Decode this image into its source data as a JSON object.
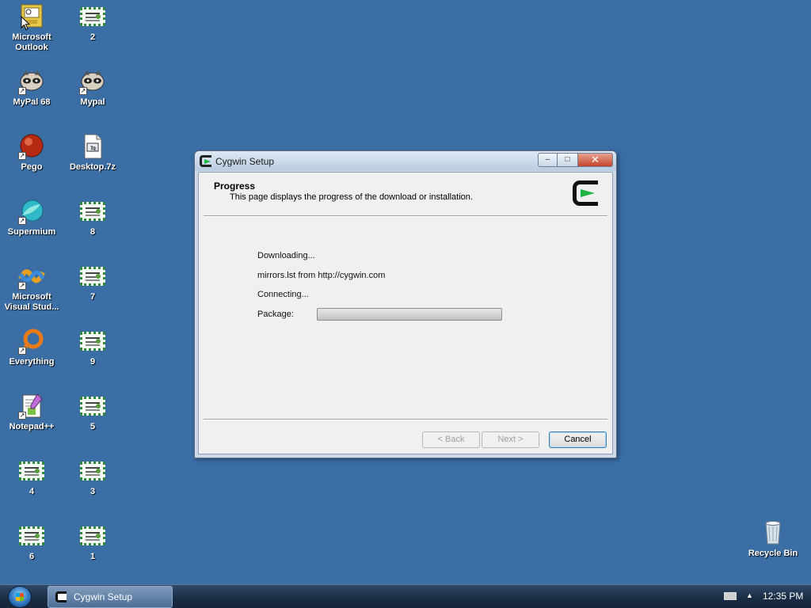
{
  "desktop": {
    "icons": [
      {
        "label": "Microsoft\nOutlook",
        "icon": "outlook-icon"
      },
      {
        "label": "2",
        "icon": "certificate-file-icon"
      },
      {
        "label": "MyPal 68",
        "icon": "raccoon-icon"
      },
      {
        "label": "Mypal",
        "icon": "raccoon-icon"
      },
      {
        "label": "Pego",
        "icon": "red-orb-icon"
      },
      {
        "label": "Desktop.7z",
        "icon": "archive-file-icon"
      },
      {
        "label": "Supermium",
        "icon": "supermium-icon"
      },
      {
        "label": "8",
        "icon": "certificate-file-icon"
      },
      {
        "label": "Microsoft\nVisual Stud...",
        "icon": "visual-studio-icon"
      },
      {
        "label": "7",
        "icon": "certificate-file-icon"
      },
      {
        "label": "Everything",
        "icon": "everything-search-icon"
      },
      {
        "label": "9",
        "icon": "certificate-file-icon"
      },
      {
        "label": "Notepad++",
        "icon": "notepad-plus-plus-icon"
      },
      {
        "label": "5",
        "icon": "certificate-file-icon"
      },
      {
        "label": "4",
        "icon": "certificate-file-icon"
      },
      {
        "label": "3",
        "icon": "certificate-file-icon"
      },
      {
        "label": "6",
        "icon": "certificate-file-icon"
      },
      {
        "label": "1",
        "icon": "certificate-file-icon"
      },
      {
        "label": "Recycle Bin",
        "icon": "recycle-bin-icon"
      }
    ]
  },
  "window": {
    "title": "Cygwin Setup",
    "controls": {
      "minimize": "–",
      "maximize": "□",
      "close": "✕"
    },
    "heading": "Progress",
    "subheading": "This page displays the progress of the download or installation.",
    "status": {
      "action": "Downloading...",
      "detail": "mirrors.lst from http://cygwin.com",
      "state": "Connecting...",
      "package_label": "Package:"
    },
    "package_progress": 0,
    "buttons": {
      "back": "< Back",
      "next": "Next >",
      "cancel": "Cancel"
    }
  },
  "taskbar": {
    "task_title": "Cygwin Setup",
    "clock": "12:35 PM",
    "tray_arrow": "▲"
  },
  "colors": {
    "desktop_bg": "#3a6ea5",
    "cygwin_green": "#1db543"
  }
}
